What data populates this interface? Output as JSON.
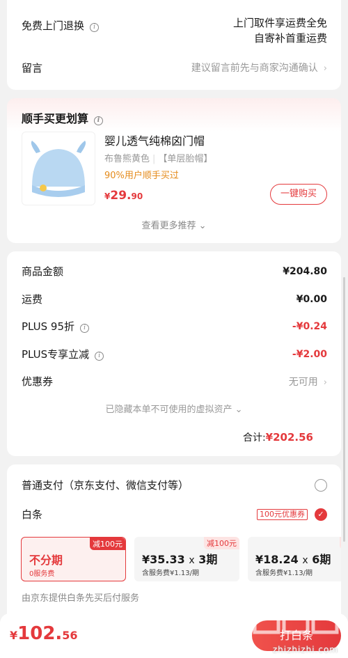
{
  "top_card": {
    "return_label": "免费上门退换",
    "return_value_line1": "上门取件享运费全免",
    "return_value_line2": "自寄补首重运费",
    "message_label": "留言",
    "message_placeholder": "建议留言前先与商家沟通确认"
  },
  "recommend": {
    "title": "顺手买更划算",
    "product_name": "婴儿透气纯棉囟门帽",
    "spec_color": "布鲁熊黄色",
    "spec_type": "【单层胎帽】",
    "tag": "90%用户顺手买过",
    "price_currency": "¥",
    "price_int": "29.",
    "price_dec": "90",
    "buy_button": "一键购买",
    "more_label": "查看更多推荐"
  },
  "amounts": {
    "rows": [
      {
        "label": "商品金额",
        "value": "¥204.80"
      },
      {
        "label": "运费",
        "value": "¥0.00"
      },
      {
        "label": "PLUS 95折",
        "value": "-¥0.24"
      },
      {
        "label": "PLUS专享立减",
        "value": "-¥2.00"
      },
      {
        "label": "优惠券",
        "value": "无可用"
      }
    ],
    "hidden_note": "已隐藏本单不可使用的虚拟资产",
    "total_label": "合计:",
    "total_value": "¥202.56"
  },
  "payment": {
    "normal_label": "普通支付（京东支付、微信支付等）",
    "baitiao_label": "白条",
    "coupon_tag": "100元优惠券",
    "plans": [
      {
        "badge": "减100元",
        "main": "不分期",
        "term": "",
        "sub": "0服务费",
        "selected": true
      },
      {
        "badge": "减100元",
        "main": "¥35.33",
        "term": "3期",
        "sub": "含服务费¥1.13/期",
        "selected": false
      },
      {
        "badge": "减",
        "main": "¥18.24",
        "term": "6期",
        "sub": "含服务费¥1.13/期",
        "selected": false
      }
    ],
    "note": "由京东提供白条先买后付服务"
  },
  "bottom": {
    "price_currency": "¥",
    "price_int": "102.",
    "price_dec": "56",
    "submit_label": "打白条",
    "watermark_site": "zhizhizhi.com"
  },
  "colors": {
    "accent": "#e4393c",
    "tag_orange": "#e58b1b"
  }
}
